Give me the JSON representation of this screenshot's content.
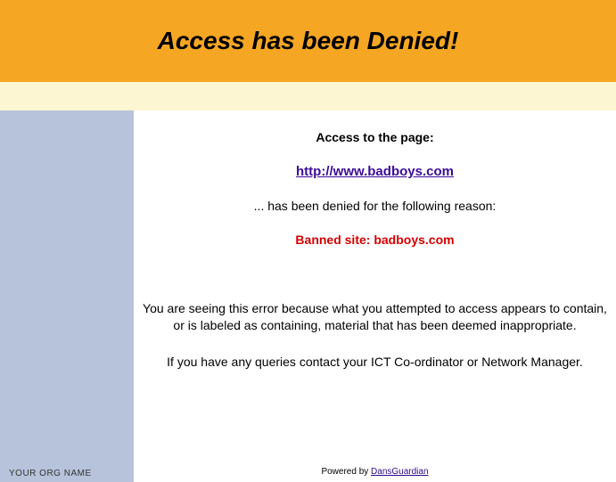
{
  "header": {
    "title": "Access has been Denied!"
  },
  "sidebar": {
    "org_name": "YOUR ORG NAME"
  },
  "main": {
    "access_line": "Access to the page:",
    "url": "http://www.badboys.com",
    "reason_intro": "... has been denied for the following reason:",
    "reason_text": "Banned site: badboys.com",
    "explain_1": "You are seeing this error because what you attempted to access appears to contain, or is labeled as containing, material that has been deemed inappropriate.",
    "explain_2": "If you have any queries contact your ICT Co-ordinator or Network Manager."
  },
  "footer": {
    "powered_prefix": "Powered by ",
    "powered_link": "DansGuardian"
  }
}
